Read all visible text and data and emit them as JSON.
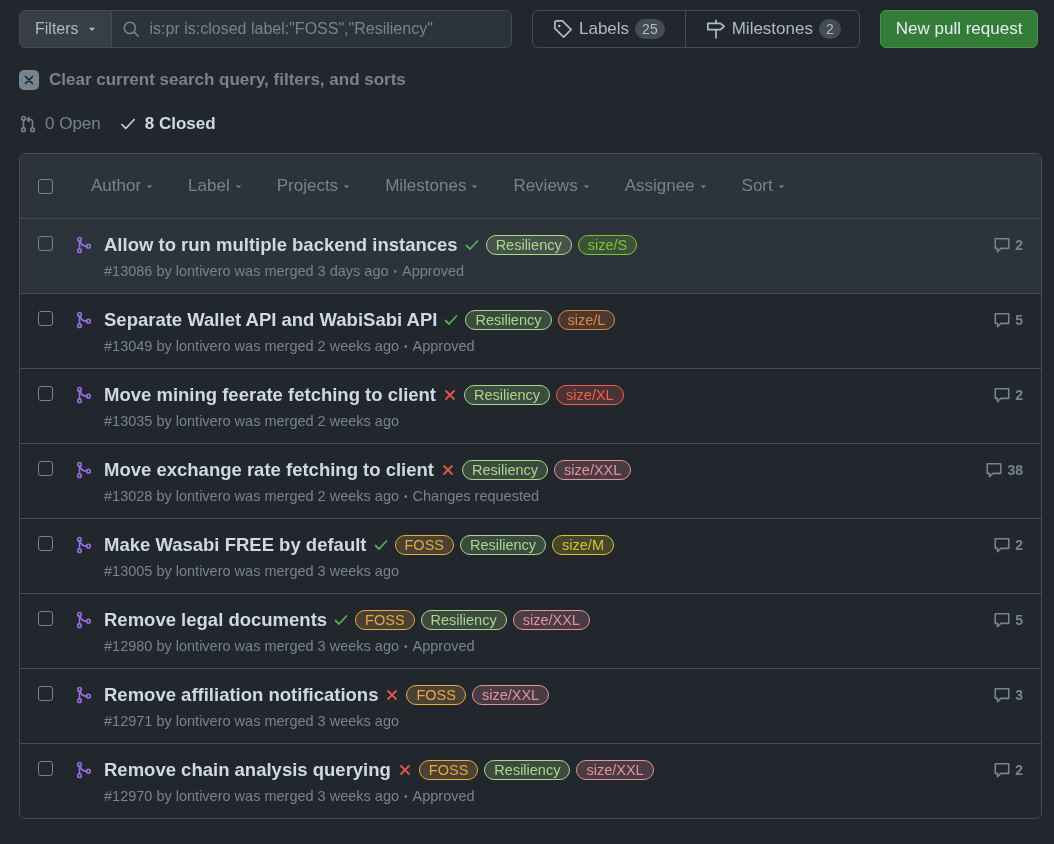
{
  "toolbar": {
    "filters_button": "Filters",
    "search": {
      "value": "is:pr is:closed label:\"FOSS\",\"Resiliency\""
    },
    "labels": {
      "label": "Labels",
      "count": "25"
    },
    "milestones": {
      "label": "Milestones",
      "count": "2"
    },
    "new_button": "New pull request"
  },
  "clear_filters": "Clear current search query, filters, and sorts",
  "states": [
    {
      "kind": "open",
      "label": "0 Open",
      "selected": false
    },
    {
      "kind": "closed",
      "label": "8 Closed",
      "selected": true
    }
  ],
  "table": {
    "select_all": {
      "checked": false
    },
    "header_filters": [
      "Author",
      "Label",
      "Projects",
      "Milestones",
      "Reviews",
      "Assignee",
      "Sort"
    ],
    "rows": [
      {
        "title": "Allow to run multiple backend instances",
        "checked": false,
        "checks_passed": true,
        "hovered": true,
        "labels": [
          {
            "text": "Resiliency",
            "color": "#a8d98a"
          },
          {
            "text": "size/S",
            "color": "#7cc72f"
          }
        ],
        "meta": "#13086 by lontivero was merged 3 days ago",
        "review": {
          "separator": "•",
          "text": "Approved"
        },
        "comments": "2"
      },
      {
        "title": "Separate Wallet API and WabiSabi API",
        "checked": false,
        "checks_passed": true,
        "hovered": false,
        "labels": [
          {
            "text": "Resiliency",
            "color": "#a8d98a"
          },
          {
            "text": "size/L",
            "color": "#e5843d"
          }
        ],
        "meta": "#13049 by lontivero was merged 2 weeks ago",
        "review": {
          "separator": "•",
          "text": "Approved"
        },
        "comments": "5"
      },
      {
        "title": "Move mining feerate fetching to client",
        "checked": false,
        "checks_passed": false,
        "hovered": false,
        "labels": [
          {
            "text": "Resiliency",
            "color": "#a8d98a"
          },
          {
            "text": "size/XL",
            "color": "#f0604f"
          }
        ],
        "meta": "#13035 by lontivero was merged 2 weeks ago",
        "comments": "2"
      },
      {
        "title": "Move exchange rate fetching to client",
        "checked": false,
        "checks_passed": false,
        "hovered": false,
        "labels": [
          {
            "text": "Resiliency",
            "color": "#a8d98a"
          },
          {
            "text": "size/XXL",
            "color": "#e8909c"
          }
        ],
        "meta": "#13028 by lontivero was merged 2 weeks ago",
        "review": {
          "separator": "•",
          "text": "Changes requested"
        },
        "comments": "38"
      },
      {
        "title": "Make Wasabi FREE by default",
        "checked": false,
        "checks_passed": true,
        "hovered": false,
        "labels": [
          {
            "text": "FOSS",
            "color": "#e5a845"
          },
          {
            "text": "Resiliency",
            "color": "#a8d98a"
          },
          {
            "text": "size/M",
            "color": "#d6c22a"
          }
        ],
        "meta": "#13005 by lontivero was merged 3 weeks ago",
        "comments": "2"
      },
      {
        "title": "Remove legal documents",
        "checked": false,
        "checks_passed": true,
        "hovered": false,
        "labels": [
          {
            "text": "FOSS",
            "color": "#e5a845"
          },
          {
            "text": "Resiliency",
            "color": "#a8d98a"
          },
          {
            "text": "size/XXL",
            "color": "#e8909c"
          }
        ],
        "meta": "#12980 by lontivero was merged 3 weeks ago",
        "review": {
          "separator": "•",
          "text": "Approved"
        },
        "comments": "5"
      },
      {
        "title": "Remove affiliation notifications",
        "checked": false,
        "checks_passed": false,
        "hovered": false,
        "labels": [
          {
            "text": "FOSS",
            "color": "#e5a845"
          },
          {
            "text": "size/XXL",
            "color": "#e8909c"
          }
        ],
        "meta": "#12971 by lontivero was merged 3 weeks ago",
        "comments": "3"
      },
      {
        "title": "Remove chain analysis querying",
        "checked": false,
        "checks_passed": false,
        "hovered": false,
        "labels": [
          {
            "text": "FOSS",
            "color": "#e5a845"
          },
          {
            "text": "Resiliency",
            "color": "#a8d98a"
          },
          {
            "text": "size/XXL",
            "color": "#e8909c"
          }
        ],
        "meta": "#12970 by lontivero was merged 3 weeks ago",
        "review": {
          "separator": "•",
          "text": "Approved"
        },
        "comments": "2"
      }
    ]
  }
}
